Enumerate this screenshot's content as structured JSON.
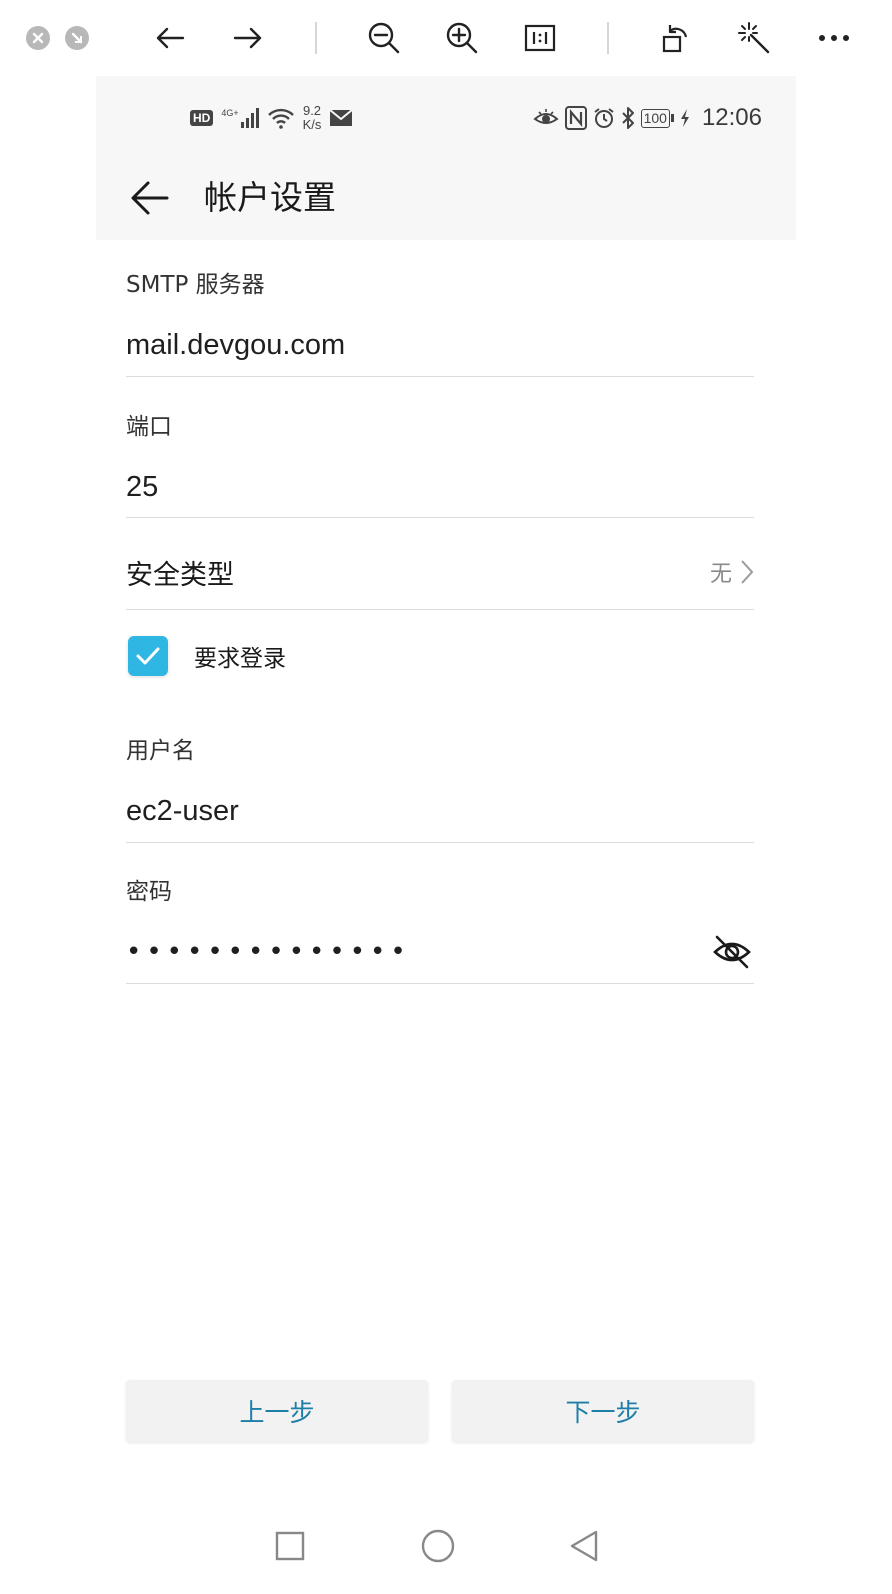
{
  "viewer": {
    "buttons": [
      "close",
      "minimize",
      "back",
      "forward",
      "zoom-out",
      "zoom-in",
      "actual-size",
      "rotate",
      "magic-wand",
      "more"
    ]
  },
  "status_bar": {
    "hd": "HD",
    "network": "4G+",
    "speed_value": "9.2",
    "speed_unit": "K/s",
    "battery": "100",
    "time": "12:06"
  },
  "app_bar": {
    "title": "帐户设置"
  },
  "form": {
    "smtp_server": {
      "label": "SMTP 服务器",
      "value": "mail.devgou.com"
    },
    "port": {
      "label": "端口",
      "value": "25"
    },
    "security_type": {
      "label": "安全类型",
      "value": "无"
    },
    "require_login": {
      "label": "要求登录",
      "checked": true
    },
    "username": {
      "label": "用户名",
      "value": "ec2-user"
    },
    "password": {
      "label": "密码",
      "masked": "••••••••••••••"
    }
  },
  "buttons": {
    "prev": "上一步",
    "next": "下一步"
  },
  "colors": {
    "accent": "#2fb6e3",
    "button_text": "#1d7fa8",
    "bar_bg": "#f7f7f7"
  }
}
